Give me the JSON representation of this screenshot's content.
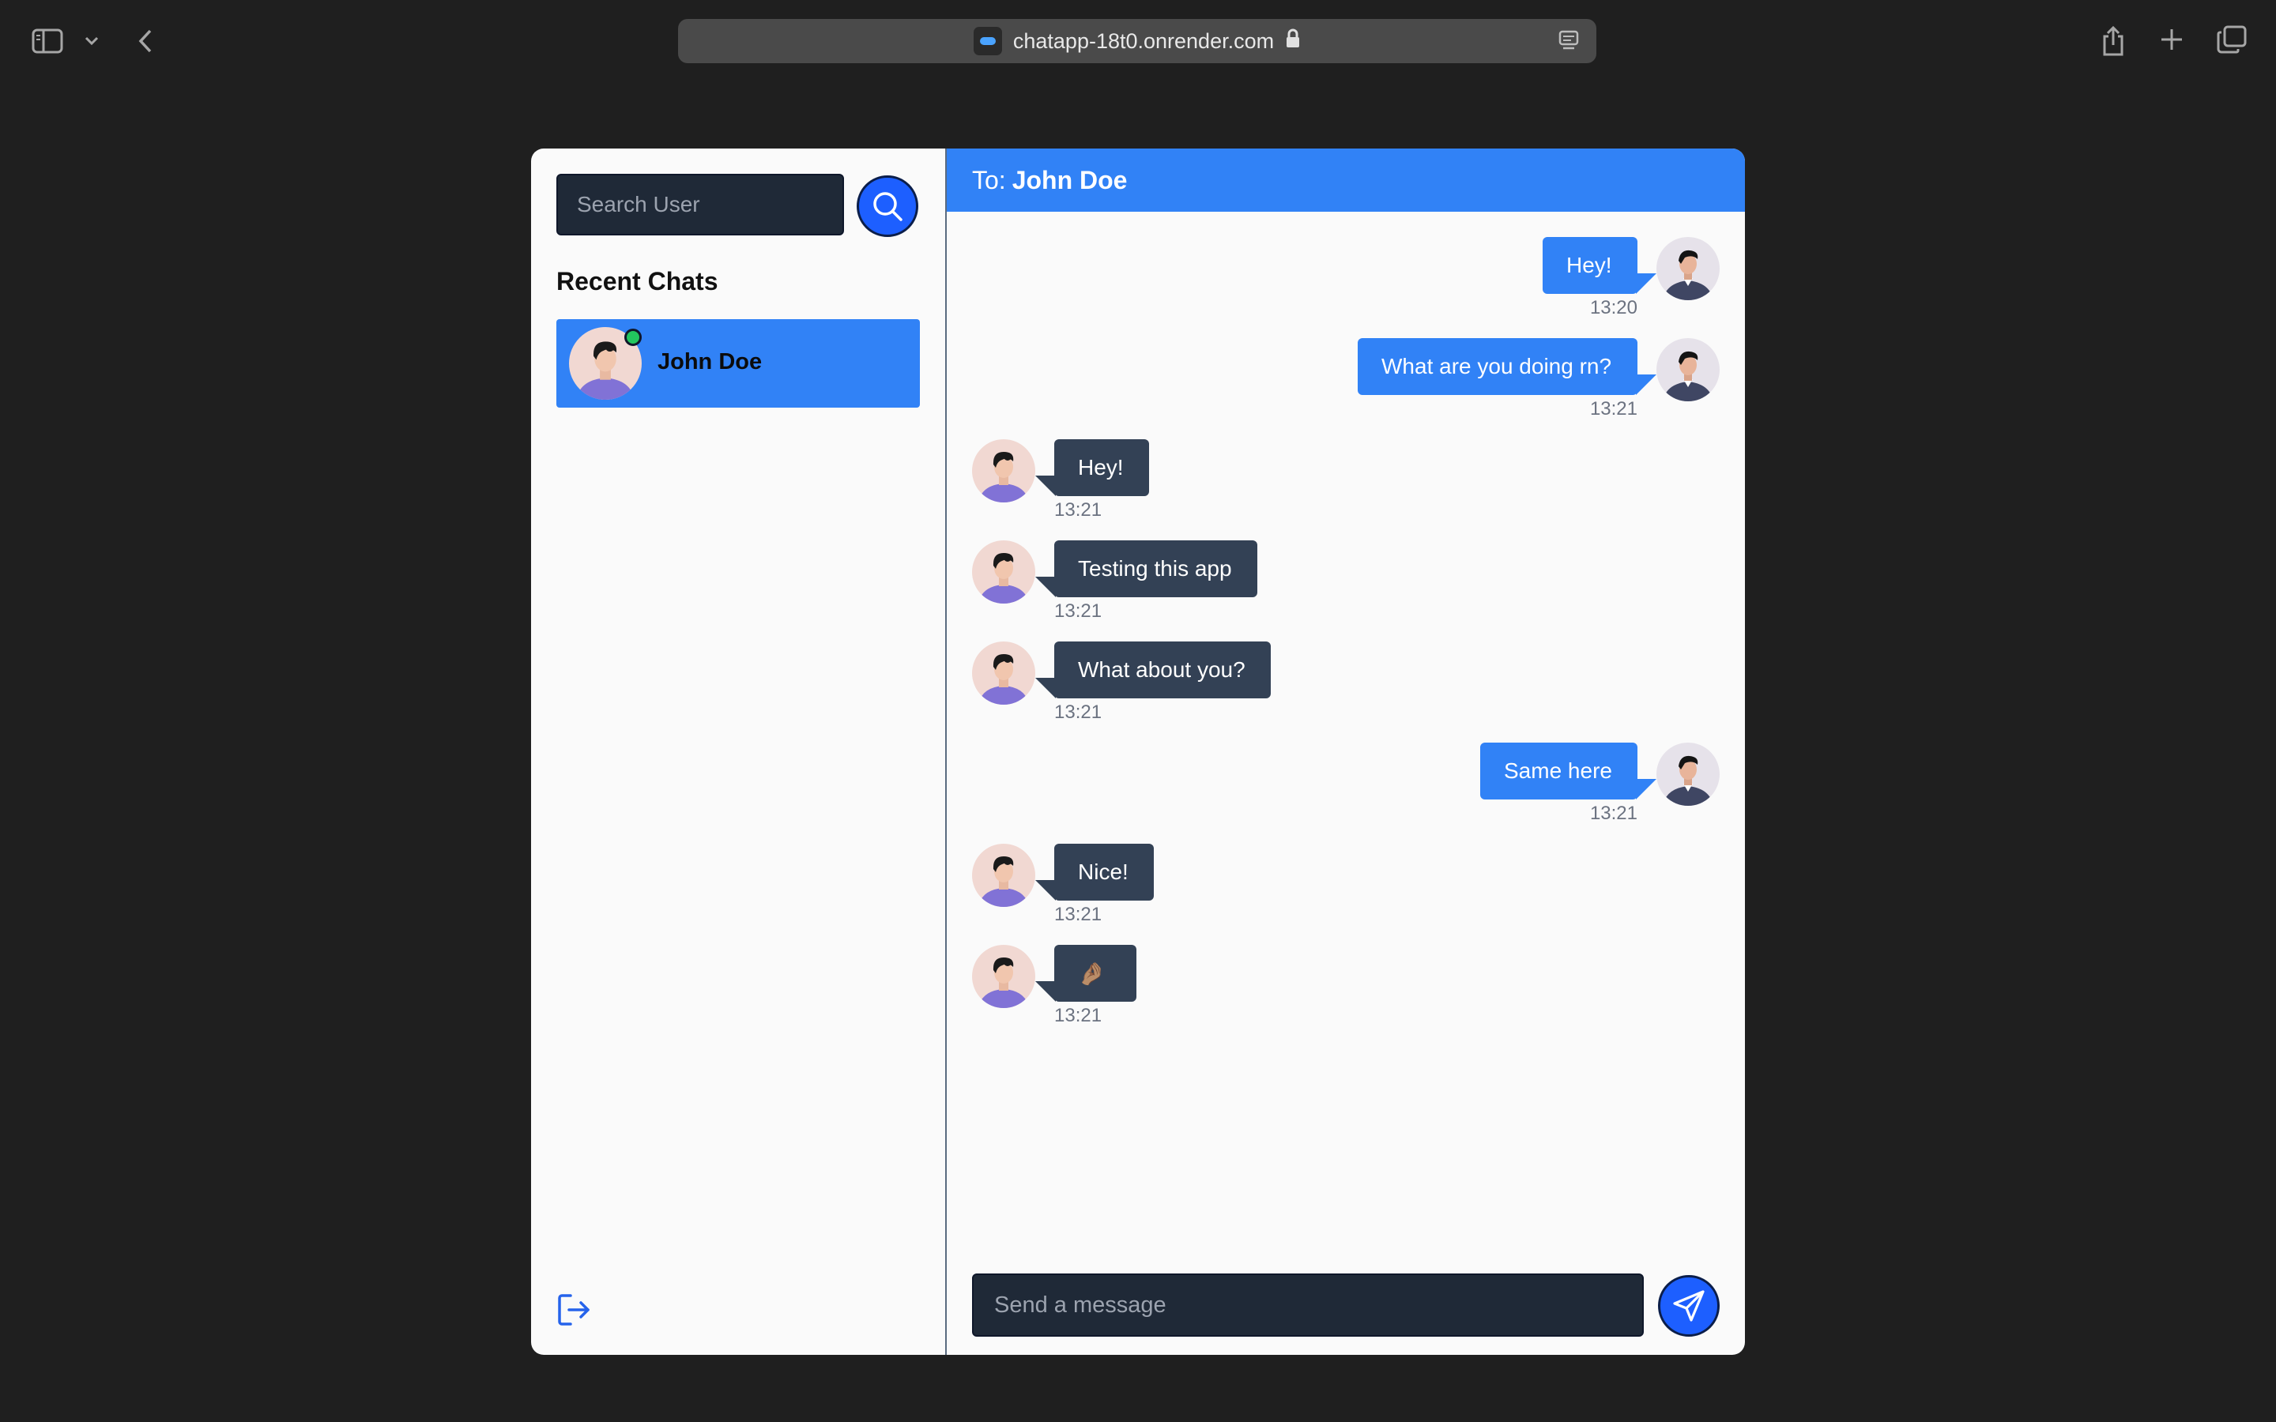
{
  "browser": {
    "url": "chatapp-18t0.onrender.com",
    "icons": [
      "sidebar-toggle-icon",
      "chevron-down-icon",
      "back-icon",
      "favicon",
      "lock-icon",
      "reader-icon",
      "share-icon",
      "new-tab-icon",
      "tabs-overview-icon"
    ]
  },
  "sidebar": {
    "search_placeholder": "Search User",
    "recent_chats_title": "Recent Chats",
    "chats": [
      {
        "name": "John Doe",
        "online": true
      }
    ]
  },
  "conversation": {
    "to_prefix": "To:",
    "recipient": "John Doe",
    "messages": [
      {
        "from": "me",
        "text": "Hey!",
        "time": "13:20"
      },
      {
        "from": "me",
        "text": "What are you doing rn?",
        "time": "13:21"
      },
      {
        "from": "them",
        "text": "Hey!",
        "time": "13:21"
      },
      {
        "from": "them",
        "text": "Testing this app",
        "time": "13:21"
      },
      {
        "from": "them",
        "text": "What about you?",
        "time": "13:21"
      },
      {
        "from": "me",
        "text": "Same here",
        "time": "13:21"
      },
      {
        "from": "them",
        "text": "Nice!",
        "time": "13:21"
      },
      {
        "from": "them",
        "text": "🤌🏽",
        "time": "13:21"
      }
    ],
    "composer_placeholder": "Send a message"
  },
  "colors": {
    "accent": "#3182f6",
    "button": "#1d5fff",
    "incoming_bubble": "#334155",
    "online": "#22c55e",
    "page_bg": "#1f1f1f"
  }
}
